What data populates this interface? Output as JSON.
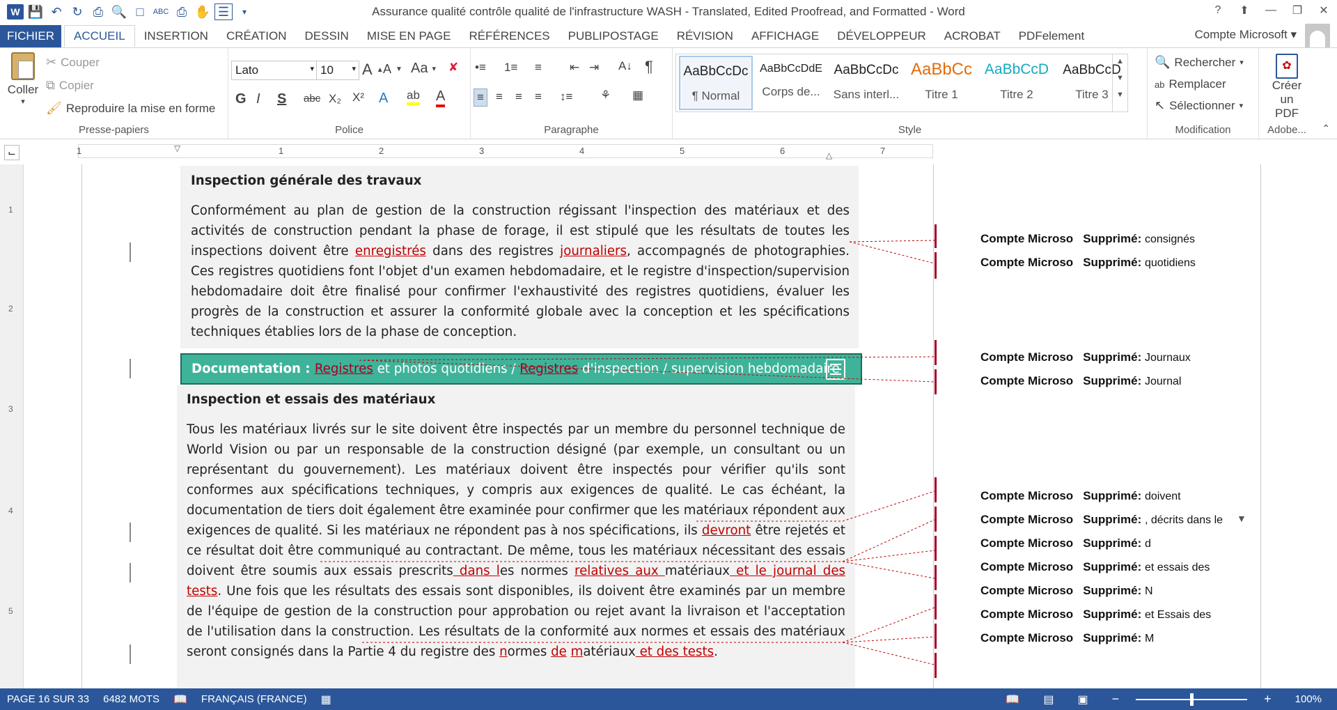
{
  "window": {
    "title": "Assurance qualité  contrôle qualité de l'infrastructure WASH - Translated, Edited Proofread, and Formatted - Word",
    "app_logo": "W",
    "help": "?",
    "controls": [
      "help-icon",
      "ribbon-display-icon",
      "minimize-icon",
      "restore-icon",
      "close-icon"
    ]
  },
  "tabs": [
    "FICHIER",
    "ACCUEIL",
    "INSERTION",
    "CRÉATION",
    "DESSIN",
    "MISE EN PAGE",
    "RÉFÉRENCES",
    "PUBLIPOSTAGE",
    "RÉVISION",
    "AFFICHAGE",
    "DÉVELOPPEUR",
    "ACROBAT",
    "PDFelement"
  ],
  "account": "Compte Microsoft",
  "clipboard": {
    "paste": "Coller",
    "cut": "Couper",
    "copy": "Copier",
    "format_painter": "Reproduire la mise en forme",
    "label": "Presse-papiers"
  },
  "font": {
    "name": "Lato",
    "size": "10",
    "label": "Police",
    "case": "Aa",
    "bold": "G",
    "italic": "I",
    "underline": "S",
    "strike": "abc",
    "subscript": "X₂",
    "superscript": "X²"
  },
  "paragraph": {
    "label": "Paragraphe"
  },
  "styles": {
    "label": "Style",
    "items": [
      {
        "preview": "AaBbCcDc",
        "name": "¶ Normal"
      },
      {
        "preview": "AaBbCcDdE",
        "name": "Corps de..."
      },
      {
        "preview": "AaBbCcDc",
        "name": "Sans interl..."
      },
      {
        "preview": "AaBbCc",
        "name": "Titre 1"
      },
      {
        "preview": "AaBbCcD",
        "name": "Titre 2"
      },
      {
        "preview": "AaBbCcD",
        "name": "Titre 3"
      }
    ],
    "colors": {
      "title1": "#e36c0a",
      "title2": "#17a9c4"
    }
  },
  "editing": {
    "find": "Rechercher",
    "replace": "Remplacer",
    "select": "Sélectionner",
    "label": "Modification"
  },
  "adobe": {
    "create": "Créer",
    "pdf": "un PDF",
    "label": "Adobe..."
  },
  "ruler": {
    "numbers": [
      "1",
      "1",
      "2",
      "3",
      "4",
      "5",
      "6",
      "7"
    ]
  },
  "vruler": {
    "numbers": [
      "1",
      "2",
      "3",
      "4",
      "5"
    ]
  },
  "doc": {
    "section1_title": "Inspection générale des travaux",
    "p1": [
      {
        "t": "Conformément au plan de gestion de la construction régissant l'inspection des matériaux et des activités de construction pendant la phase de forage, il est stipulé que les résultats de toutes les inspections doivent être "
      },
      {
        "t": "enregistrés",
        "ins": true
      },
      {
        "t": " dans des registres "
      },
      {
        "t": "journaliers",
        "ins": true
      },
      {
        "t": ", accompagnés de photographies. Ces registres quotidiens font l'objet d'un examen hebdomadaire, et le registre d'inspection/supervision hebdomadaire doit être finalisé pour confirmer l'exhaustivité des registres quotidiens, évaluer les progrès de la construction et assurer la conformité globale avec la conception et les spécifications techniques établies lors de la phase de conception."
      }
    ],
    "docbar": [
      {
        "t": "Documentation : ",
        "bold": true
      },
      {
        "t": "Registres",
        "ins": true
      },
      {
        "t": " et photos quotidiens / "
      },
      {
        "t": "Registres",
        "ins": true
      },
      {
        "t": " d'inspection / supervision hebdomadaire"
      }
    ],
    "section2_title": "Inspection et essais des matériaux",
    "p2": [
      {
        "t": "Tous les matériaux livrés sur le site doivent être inspectés par un membre du personnel technique de World Vision ou par un responsable de la construction désigné (par exemple, un consultant ou un représentant du gouvernement). Les matériaux doivent être inspectés pour vérifier qu'ils sont conformes aux spécifications techniques, y compris aux exigences de qualité. Le cas échéant, la documentation de tiers doit également être examinée pour confirmer que les matériaux répondent aux exigences de qualité. Si les matériaux ne répondent pas à nos spécifications, ils "
      },
      {
        "t": "devront",
        "ins": true
      },
      {
        "t": " être rejetés et ce résultat doit être communiqué au contractant. De même, tous les matériaux nécessitant des essais doivent être soumis aux essais prescrits"
      },
      {
        "t": " dans ",
        "ins": true
      },
      {
        "t": "l",
        "ins": true
      },
      {
        "t": "es normes "
      },
      {
        "t": "relatives aux ",
        "ins": true
      },
      {
        "t": " matériaux"
      },
      {
        "t": " et le journal des tests",
        "ins": true
      },
      {
        "t": ". Une fois que les résultats des essais sont disponibles, ils doivent être examinés par un membre de l'équipe de gestion de la construction pour approbation ou rejet avant la livraison et l'acceptation de l'utilisation dans la construction. Les résultats de la conformité aux normes et essais des matériaux seront consignés dans la Partie 4 du registre des "
      },
      {
        "t": "n",
        "ins": true
      },
      {
        "t": "ormes "
      },
      {
        "t": "de",
        "ins": true
      },
      {
        "t": " "
      },
      {
        "t": "m",
        "ins": true
      },
      {
        "t": "atériaux"
      },
      {
        "t": " et des tests",
        "ins": true
      },
      {
        "t": "."
      }
    ]
  },
  "comments": [
    {
      "author": "Compte Microso",
      "kind": "Supprimé:",
      "text": "consignés"
    },
    {
      "author": "Compte Microso",
      "kind": "Supprimé:",
      "text": "quotidiens"
    },
    {
      "author": "Compte Microso",
      "kind": "Supprimé:",
      "text": "Journaux"
    },
    {
      "author": "Compte Microso",
      "kind": "Supprimé:",
      "text": "Journal"
    },
    {
      "author": "Compte Microso",
      "kind": "Supprimé:",
      "text": "doivent"
    },
    {
      "author": "Compte Microso",
      "kind": "Supprimé:",
      "text": ", décrits dans le"
    },
    {
      "author": "Compte Microso",
      "kind": "Supprimé:",
      "text": "d"
    },
    {
      "author": "Compte Microso",
      "kind": "Supprimé:",
      "text": "et essais des"
    },
    {
      "author": "Compte Microso",
      "kind": "Supprimé:",
      "text": "N"
    },
    {
      "author": "Compte Microso",
      "kind": "Supprimé:",
      "text": "et Essais des"
    },
    {
      "author": "Compte Microso",
      "kind": "Supprimé:",
      "text": "M"
    }
  ],
  "status": {
    "page": "PAGE 16 SUR 33",
    "words": "6482 MOTS",
    "language": "FRANÇAIS (FRANCE)",
    "zoom": "100%",
    "zoom_minus": "−",
    "zoom_plus": "+"
  }
}
